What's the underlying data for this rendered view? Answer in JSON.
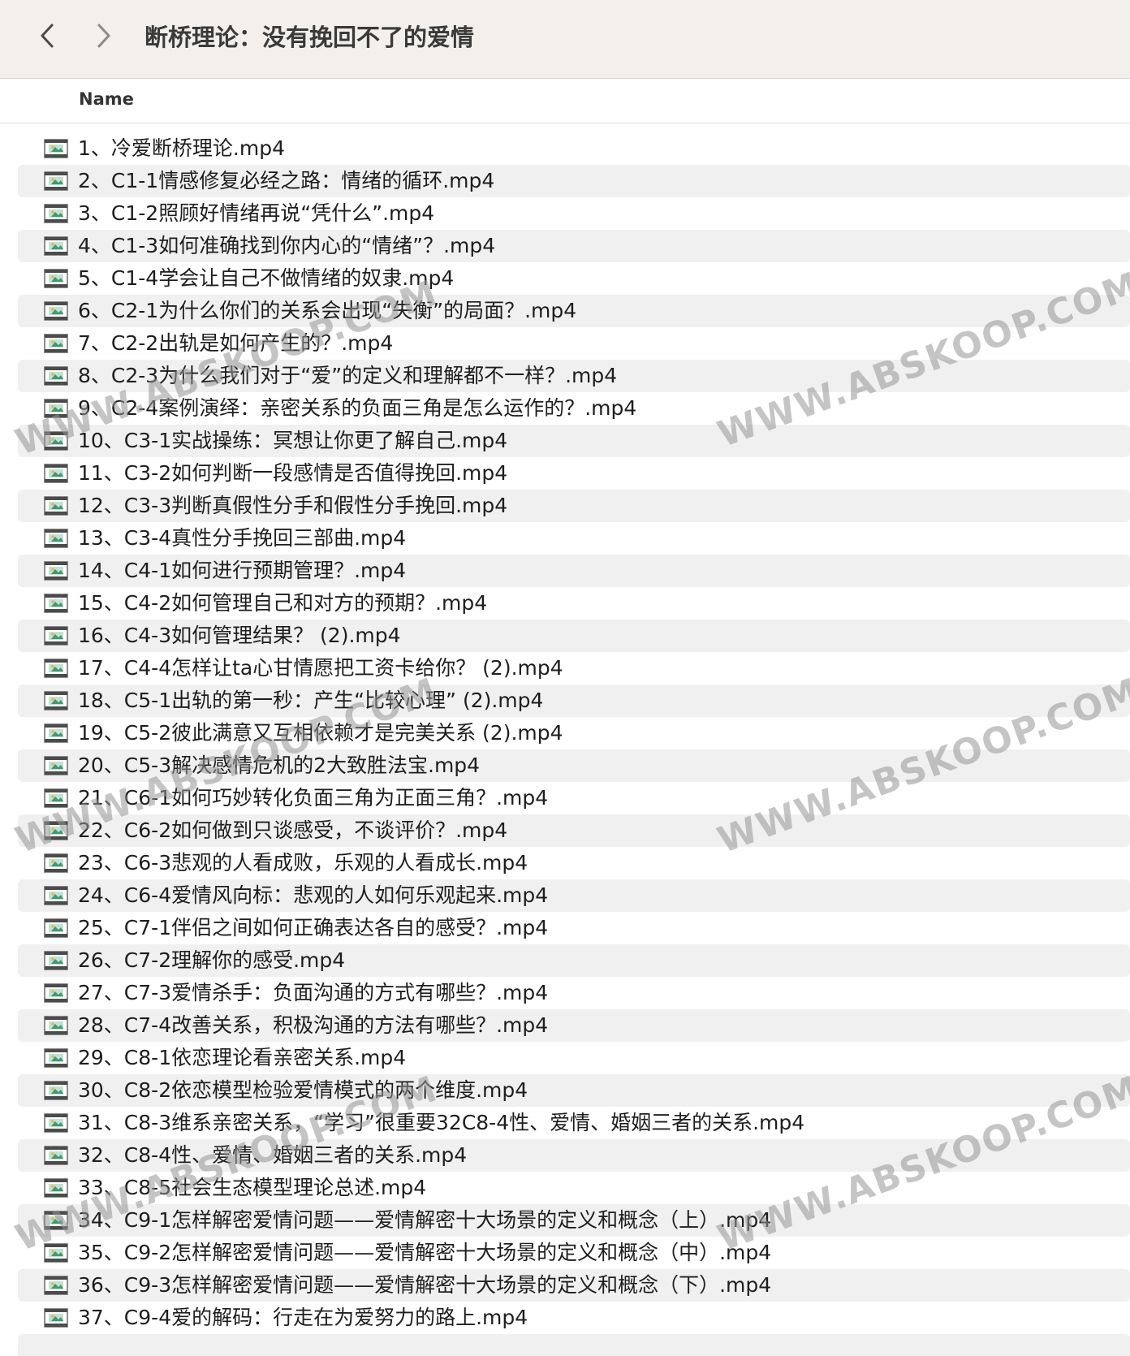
{
  "window": {
    "title": "断桥理论：没有挽回不了的爱情",
    "back_icon": "chevron-left-icon",
    "forward_icon": "chevron-right-icon"
  },
  "header": {
    "name_label": "Name"
  },
  "files": [
    "1、冷爱断桥理论.mp4",
    "2、C1-1情感修复必经之路：情绪的循环.mp4",
    "3、C1-2照顾好情绪再说“凭什么”.mp4",
    "4、C1-3如何准确找到你内心的“情绪”？.mp4",
    "5、C1-4学会让自己不做情绪的奴隶.mp4",
    "6、C2-1为什么你们的关系会出现“失衡”的局面？.mp4",
    "7、C2-2出轨是如何产生的？.mp4",
    "8、C2-3为什么我们对于“爱”的定义和理解都不一样？.mp4",
    "9、C2-4案例演绎：亲密关系的负面三角是怎么运作的？.mp4",
    "10、C3-1实战操练：冥想让你更了解自己.mp4",
    "11、C3-2如何判断一段感情是否值得挽回.mp4",
    "12、C3-3判断真假性分手和假性分手挽回.mp4",
    "13、C3-4真性分手挽回三部曲.mp4",
    "14、C4-1如何进行预期管理？.mp4",
    "15、C4-2如何管理自己和对方的预期？.mp4",
    "16、C4-3如何管理结果？ (2).mp4",
    "17、C4-4怎样让ta心甘情愿把工资卡给你？ (2).mp4",
    "18、C5-1出轨的第一秒：产生“比较心理” (2).mp4",
    "19、C5-2彼此满意又互相依赖才是完美关系 (2).mp4",
    "20、C5-3解决感情危机的2大致胜法宝.mp4",
    "21、C6-1如何巧妙转化负面三角为正面三角？.mp4",
    "22、C6-2如何做到只谈感受，不谈评价？.mp4",
    "23、C6-3悲观的人看成败，乐观的人看成长.mp4",
    "24、C6-4爱情风向标：悲观的人如何乐观起来.mp4",
    "25、C7-1伴侣之间如何正确表达各自的感受？.mp4",
    "26、C7-2理解你的感受.mp4",
    "27、C7-3爱情杀手：负面沟通的方式有哪些？.mp4",
    "28、C7-4改善关系，积极沟通的方法有哪些？.mp4",
    "29、C8-1依恋理论看亲密关系.mp4",
    "30、C8-2依恋模型检验爱情模式的两个维度.mp4",
    "31、C8-3维系亲密关系，“学习”很重要32C8-4性、爱情、婚姻三者的关系.mp4",
    "32、C8-4性、爱情、婚姻三者的关系.mp4",
    "33、C8-5社会生态模型理论总述.mp4",
    "34、C9-1怎样解密爱情问题——爱情解密十大场景的定义和概念（上）.mp4",
    "35、C9-2怎样解密爱情问题——爱情解密十大场景的定义和概念（中）.mp4",
    "36、C9-3怎样解密爱情问题——爱情解密十大场景的定义和概念（下）.mp4",
    "37、C9-4爱的解码：行走在为爱努力的路上.mp4"
  ],
  "file_icon": "video-file-icon",
  "watermark": "WWW.ABSKOOP.COM"
}
